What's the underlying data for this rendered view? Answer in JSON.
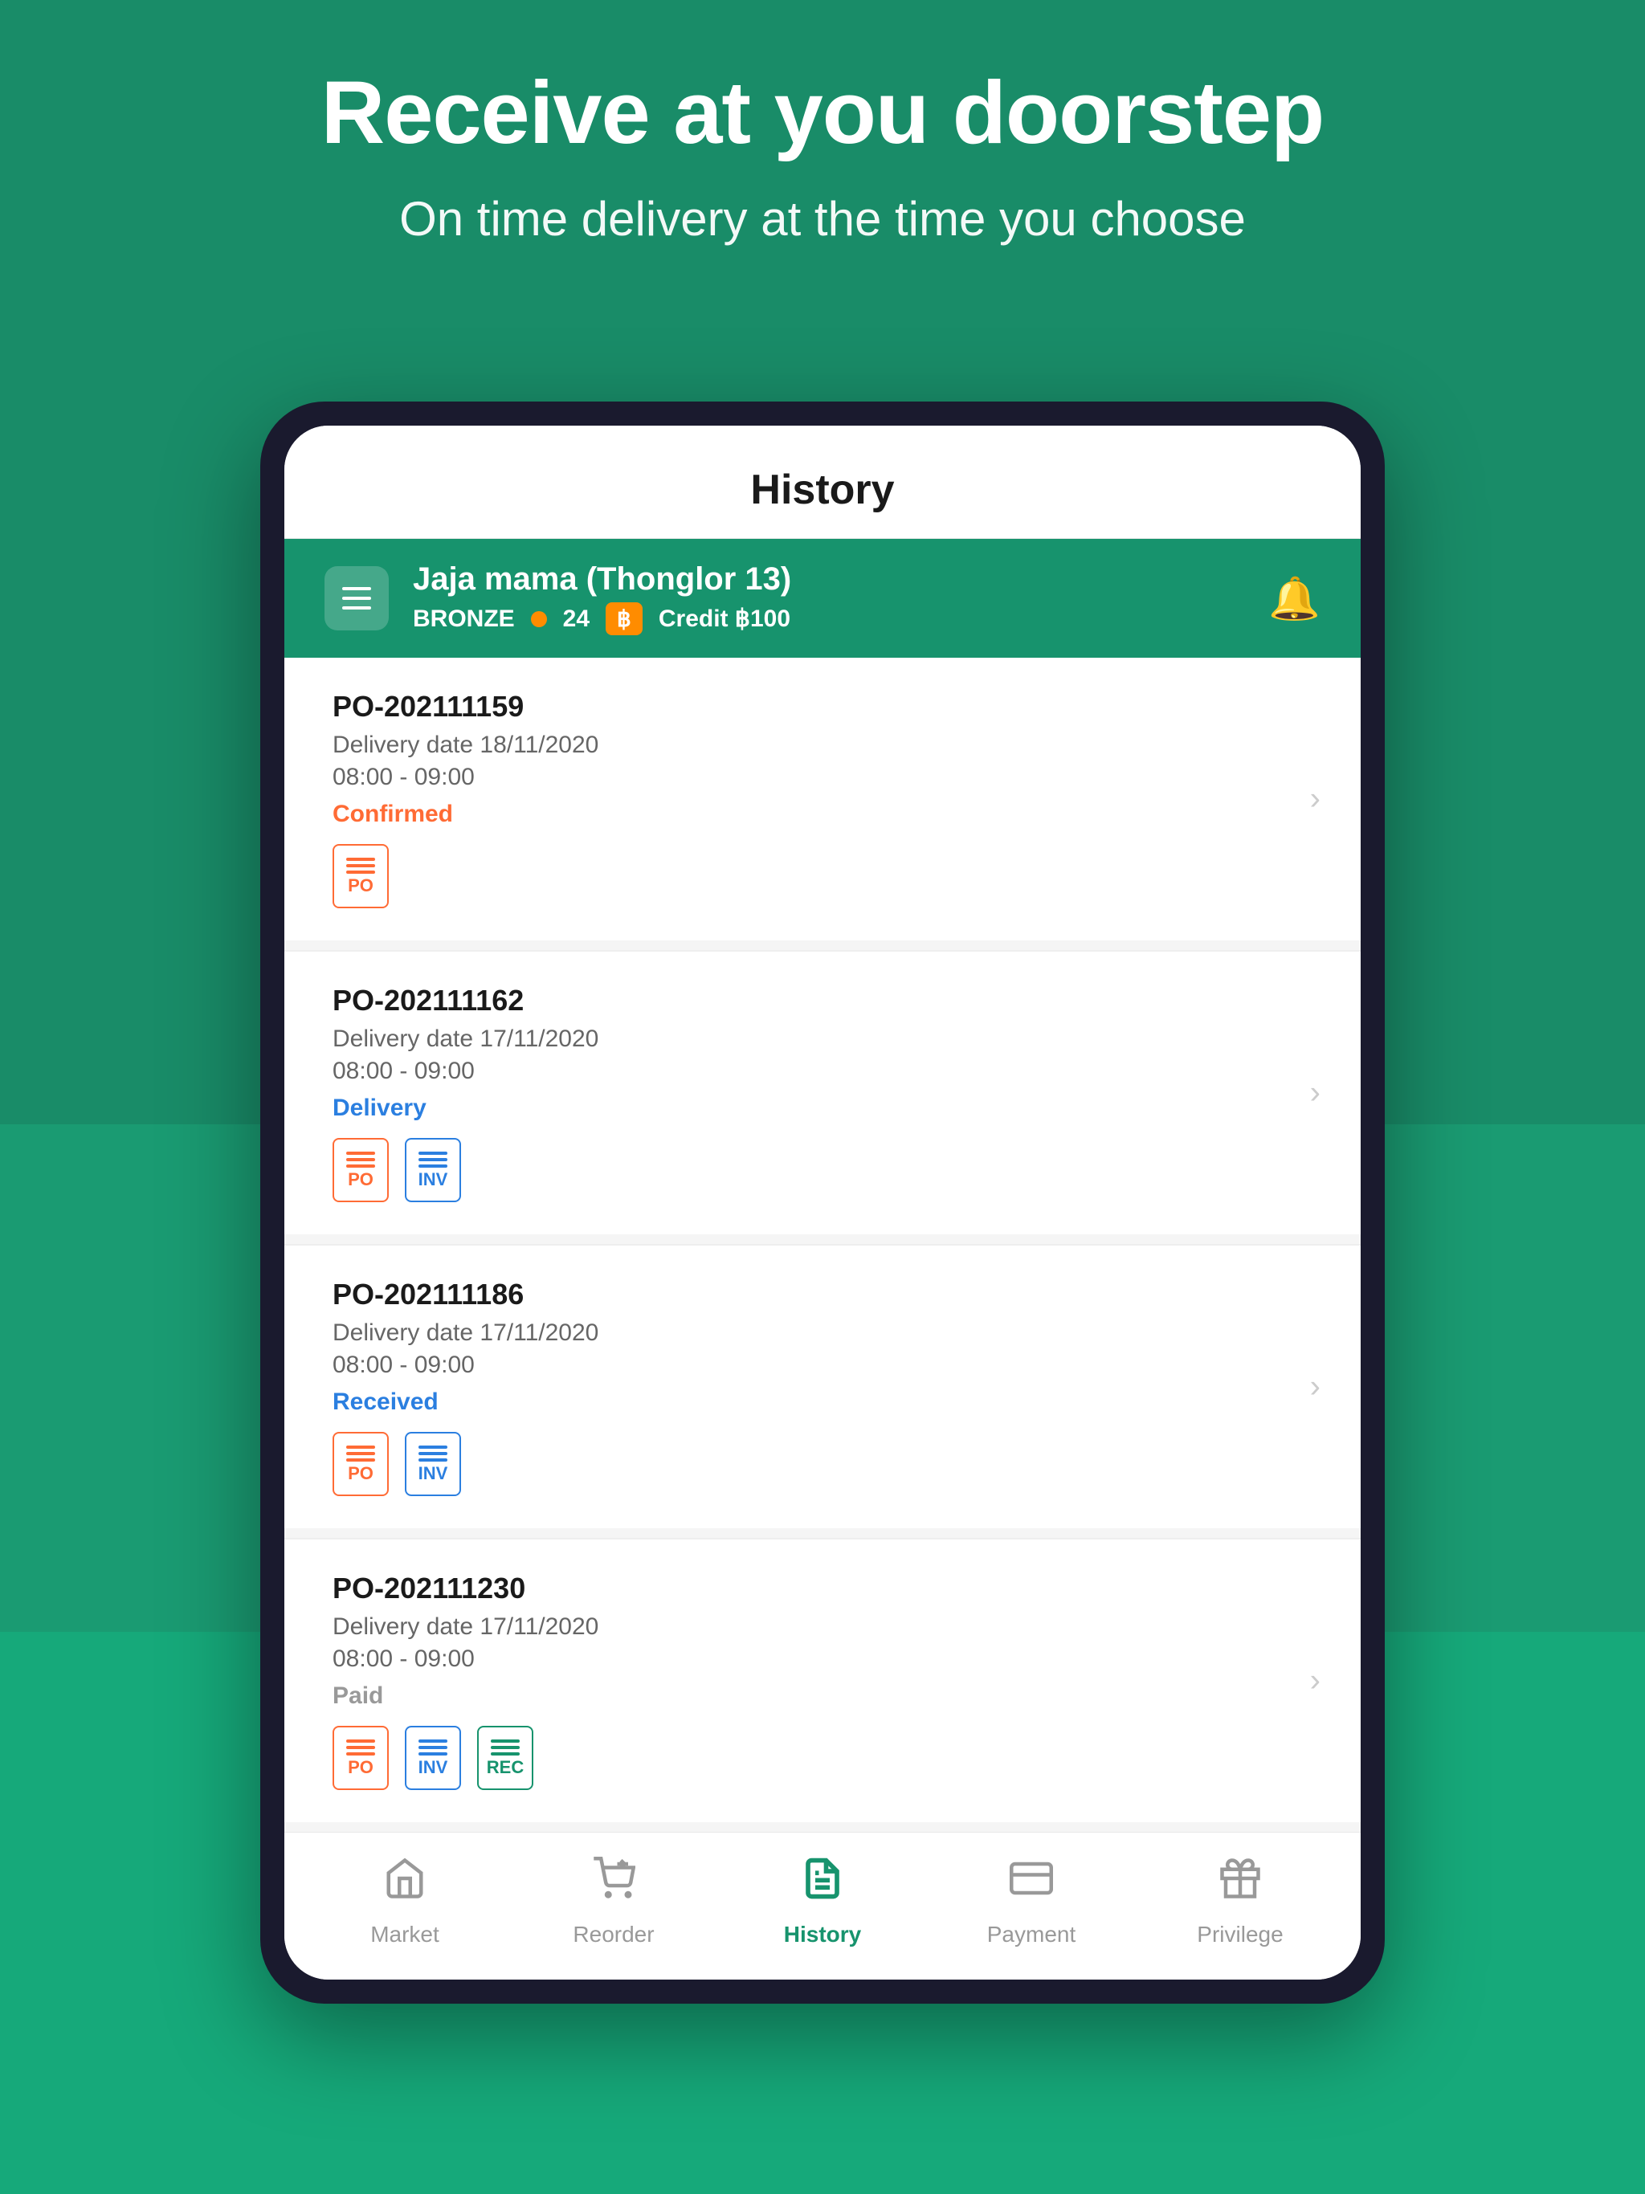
{
  "background": {
    "color_top": "#198c68",
    "color_main": "#1a9b72"
  },
  "hero": {
    "title": "Receive at you doorstep",
    "subtitle": "On time delivery at the time you choose"
  },
  "app": {
    "screen_title": "History",
    "store_bar": {
      "store_name": "Jaja mama (Thonglor 13)",
      "badge": "BRONZE",
      "points": "24",
      "credit_label": "Credit ฿100"
    },
    "orders": [
      {
        "id": "PO-202111159",
        "delivery_date": "Delivery date 18/11/2020",
        "time": "08:00 - 09:00",
        "status": "Confirmed",
        "status_type": "confirmed",
        "docs": [
          "PO"
        ]
      },
      {
        "id": "PO-202111162",
        "delivery_date": "Delivery date 17/11/2020",
        "time": "08:00 - 09:00",
        "status": "Delivery",
        "status_type": "delivery",
        "docs": [
          "PO",
          "INV"
        ]
      },
      {
        "id": "PO-202111186",
        "delivery_date": "Delivery date 17/11/2020",
        "time": "08:00 - 09:00",
        "status": "Received",
        "status_type": "received",
        "docs": [
          "PO",
          "INV"
        ]
      },
      {
        "id": "PO-202111230",
        "delivery_date": "Delivery date 17/11/2020",
        "time": "08:00 - 09:00",
        "status": "Paid",
        "status_type": "paid",
        "docs": [
          "PO",
          "INV",
          "REC"
        ]
      }
    ],
    "bottom_nav": [
      {
        "label": "Market",
        "icon": "🏠",
        "active": false
      },
      {
        "label": "Reorder",
        "icon": "🔄",
        "active": false
      },
      {
        "label": "History",
        "icon": "📄",
        "active": true
      },
      {
        "label": "Payment",
        "icon": "💳",
        "active": false
      },
      {
        "label": "Privilege",
        "icon": "🎁",
        "active": false
      }
    ]
  }
}
